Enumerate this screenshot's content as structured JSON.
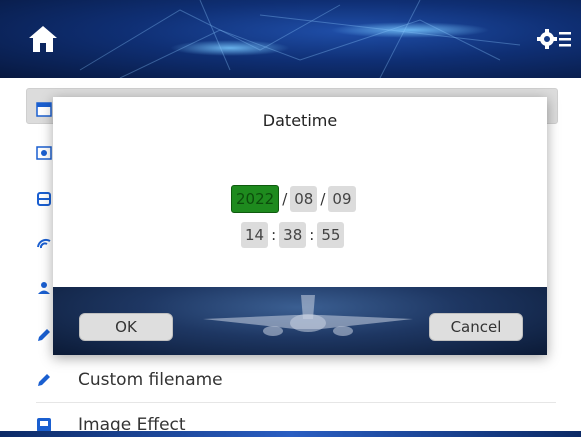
{
  "header": {
    "home_icon": "home-icon",
    "settings_icon": "settings-menu-icon"
  },
  "menu": {
    "items": [
      {
        "icon": "calendar-icon",
        "label": ""
      },
      {
        "icon": "photo-icon",
        "label": ""
      },
      {
        "icon": "storage-icon",
        "label": ""
      },
      {
        "icon": "wifi-icon",
        "label": ""
      },
      {
        "icon": "user-icon",
        "label": ""
      },
      {
        "icon": "pencil-icon",
        "label": ""
      },
      {
        "icon": "pencil-icon",
        "label": "Custom filename"
      },
      {
        "icon": "image-icon",
        "label": "Image Effect"
      }
    ]
  },
  "dialog": {
    "title": "Datetime",
    "date": {
      "year": "2022",
      "month": "08",
      "day": "09",
      "separator": "/"
    },
    "time": {
      "hour": "14",
      "minute": "38",
      "second": "55",
      "separator": ":"
    },
    "ok_label": "OK",
    "cancel_label": "Cancel"
  },
  "colors": {
    "accent_selected": "#1e8a1e",
    "header_blue": "#0f2f74",
    "icon_blue": "#1a5fd0"
  }
}
